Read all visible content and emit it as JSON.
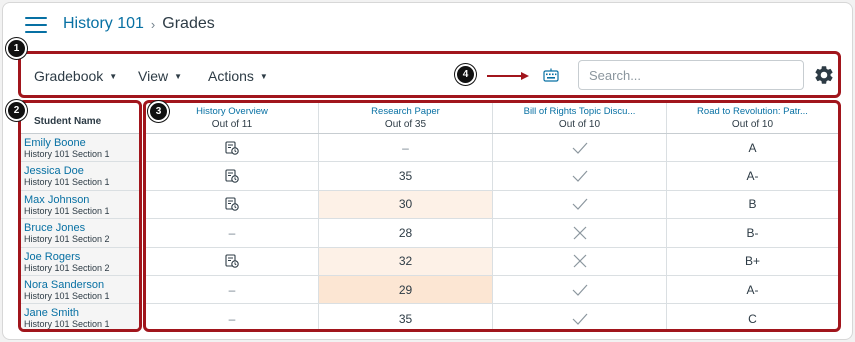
{
  "breadcrumb": {
    "course": "History 101",
    "separator": "›",
    "page": "Grades"
  },
  "toolbar": {
    "gradebook": "Gradebook",
    "view": "View",
    "actions": "Actions",
    "search_placeholder": "Search...",
    "keyboard_icon": "keyboard-shortcuts-icon",
    "settings_icon": "gear-icon"
  },
  "students_header": "Student Name",
  "students": [
    {
      "name": "Emily Boone",
      "section": "History 101 Section 1"
    },
    {
      "name": "Jessica Doe",
      "section": "History 101 Section 1"
    },
    {
      "name": "Max Johnson",
      "section": "History 101 Section 1"
    },
    {
      "name": "Bruce Jones",
      "section": "History 101 Section 2"
    },
    {
      "name": "Joe Rogers",
      "section": "History 101 Section 2"
    },
    {
      "name": "Nora Sanderson",
      "section": "History 101 Section 1"
    },
    {
      "name": "Jane Smith",
      "section": "History 101 Section 1"
    }
  ],
  "assignments": [
    {
      "title": "History Overview",
      "points": "Out of 11"
    },
    {
      "title": "Research Paper",
      "points": "Out of 35"
    },
    {
      "title": "Bill of Rights Topic Discu...",
      "points": "Out of 10"
    },
    {
      "title": "Road to Revolution: Patr...",
      "points": "Out of 10"
    }
  ],
  "grades": [
    [
      {
        "type": "submitted-icon"
      },
      {
        "type": "text",
        "value": "–"
      },
      {
        "type": "check-icon"
      },
      {
        "type": "text",
        "value": "A"
      }
    ],
    [
      {
        "type": "submitted-icon"
      },
      {
        "type": "text",
        "value": "35"
      },
      {
        "type": "check-icon"
      },
      {
        "type": "text",
        "value": "A-"
      }
    ],
    [
      {
        "type": "submitted-icon"
      },
      {
        "type": "text",
        "value": "30",
        "highlight": "light"
      },
      {
        "type": "check-icon"
      },
      {
        "type": "text",
        "value": "B"
      }
    ],
    [
      {
        "type": "text",
        "value": "–"
      },
      {
        "type": "text",
        "value": "28"
      },
      {
        "type": "x-icon"
      },
      {
        "type": "text",
        "value": "B-"
      }
    ],
    [
      {
        "type": "submitted-icon"
      },
      {
        "type": "text",
        "value": "32",
        "highlight": "light"
      },
      {
        "type": "x-icon"
      },
      {
        "type": "text",
        "value": "B+"
      }
    ],
    [
      {
        "type": "text",
        "value": "–"
      },
      {
        "type": "text",
        "value": "29",
        "highlight": "mid"
      },
      {
        "type": "check-icon"
      },
      {
        "type": "text",
        "value": "A-"
      }
    ],
    [
      {
        "type": "text",
        "value": "–"
      },
      {
        "type": "text",
        "value": "35"
      },
      {
        "type": "check-icon"
      },
      {
        "type": "text",
        "value": "C"
      }
    ]
  ],
  "callouts": [
    "1",
    "2",
    "3",
    "4"
  ],
  "colors": {
    "link": "#0770a3",
    "callout_border": "#a1151c",
    "highlight_light": "#fdf1e7",
    "highlight_mid": "#fce6d3"
  }
}
